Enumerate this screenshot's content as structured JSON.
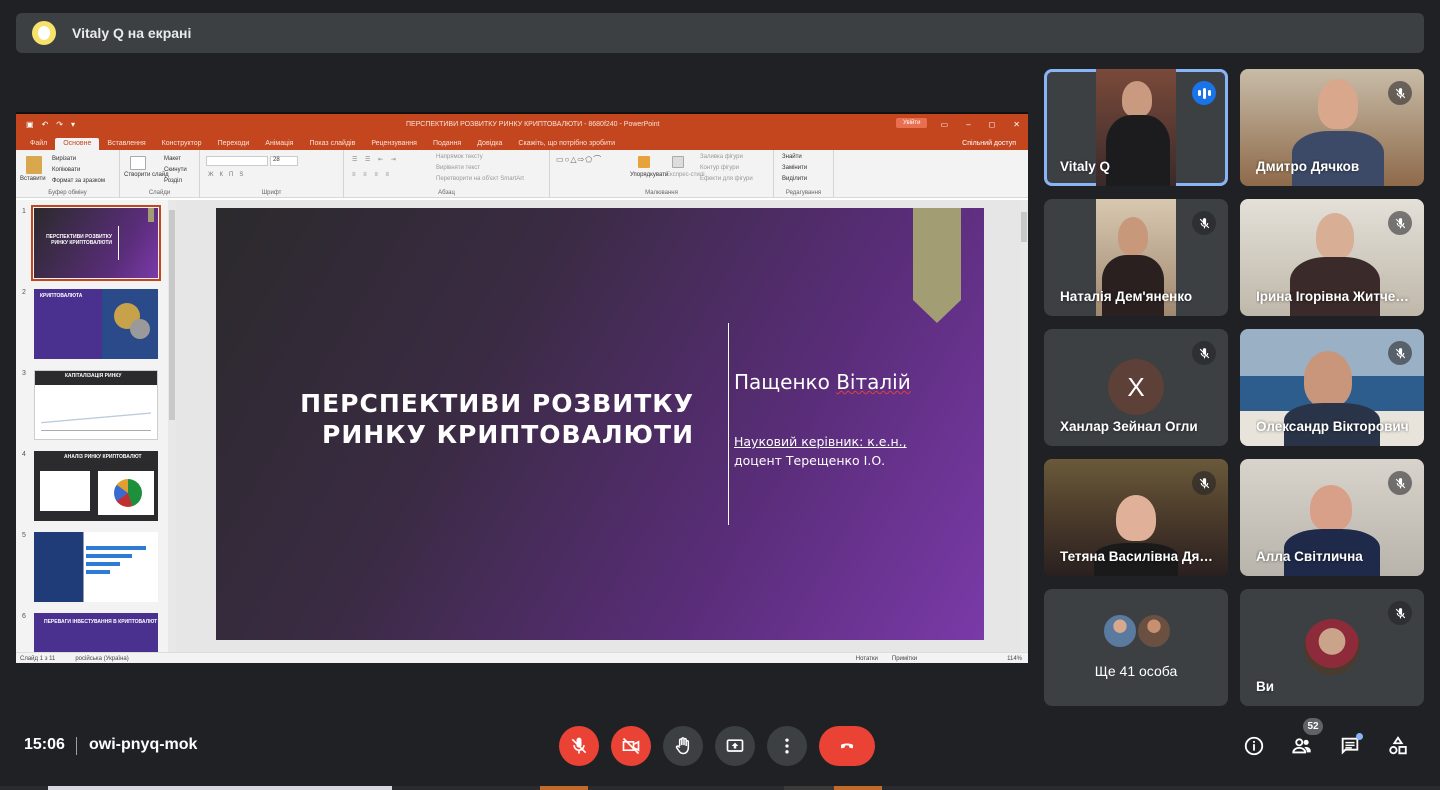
{
  "banner": {
    "text": "Vitaly Q на екрані"
  },
  "ppt": {
    "doc_title": "ПЕРСПЕКТИВИ РОЗВИТКУ РИНКУ КРИПТОВАЛЮТИ - 8680f240 - PowerPoint",
    "ukrainian_badge": "Увійти",
    "tabs": [
      "Файл",
      "Основне",
      "Вставлення",
      "Конструктор",
      "Переходи",
      "Анімація",
      "Показ слайдів",
      "Рецензування",
      "Подання",
      "Довідка",
      "Скажіть, що потрібно зробити"
    ],
    "share_label": "Спільний доступ",
    "ribbon": {
      "paste": "Вставити",
      "cut": "Вирізати",
      "copy": "Копіювати",
      "format_painter": "Формат за зразком",
      "clipboard": "Буфер обміну",
      "new_slide": "Створити слайд",
      "layout": "Макет",
      "reset": "Скинути",
      "section": "Розділ",
      "slides": "Слайди",
      "font_size": "28",
      "font": "Шрифт",
      "text_direction": "Напрямок тексту",
      "align_text": "Вирівняти текст",
      "smartart": "Перетворити на об'єкт SmartArt",
      "paragraph": "Абзац",
      "arrange": "Упорядкувати",
      "quick_styles": "Експрес-стилі",
      "shape_fill": "Заливка фігури",
      "shape_outline": "Контур фігури",
      "shape_effects": "Ефекти для фігури",
      "drawing": "Малювання",
      "find": "Знайти",
      "replace": "Замінити",
      "select": "Виділити",
      "editing": "Редагування"
    },
    "slide": {
      "title_line1": "ПЕРСПЕКТИВИ РОЗВИТКУ",
      "title_line2": "РИНКУ КРИПТОВАЛЮТИ",
      "author_first": "Пащенко",
      "author_second": "Віталій",
      "supervisor_line1": "Науковий керівник: к.е.н.,",
      "supervisor_line2": "доцент Терещенко І.О."
    },
    "thumbnails": [
      {
        "num": "1",
        "caption": "ПЕРСПЕКТИВИ РОЗВИТКУ РИНКУ КРИПТОВАЛЮТИ"
      },
      {
        "num": "2",
        "caption": "КРИПТОВАЛЮТА"
      },
      {
        "num": "3",
        "caption": "КАПІТАЛІЗАЦІЯ РИНКУ"
      },
      {
        "num": "4",
        "caption": "АНАЛІЗ РИНКУ КРИПТОВАЛЮТ"
      },
      {
        "num": "5",
        "caption": ""
      },
      {
        "num": "6",
        "caption": "ПЕРЕВАГИ ІНВЕСТУВАННЯ В КРИПТОВАЛЮТ"
      }
    ],
    "status": {
      "slide_of": "Слайд 1 з 11",
      "language": "російська (Україна)",
      "notes": "Нотатки",
      "comments": "Примітки",
      "zoom": "114%"
    }
  },
  "participants": [
    {
      "name": "Vitaly Q",
      "speaking": true
    },
    {
      "name": "Дмитро Дячков",
      "muted": true
    },
    {
      "name": "Наталія Дем'яненко",
      "muted": true
    },
    {
      "name": "Ірина Ігорівна Житченко",
      "muted": true
    },
    {
      "name": "Ханлар Зейнал Огли",
      "initial": "Х",
      "muted": true
    },
    {
      "name": "Олександр Вікторович",
      "muted": true
    },
    {
      "name": "Тетяна Василівна Дяченко",
      "muted": true
    },
    {
      "name": "Алла Світлична",
      "muted": true
    },
    {
      "name": "Ще 41 особа"
    },
    {
      "name": "Ви",
      "muted": true
    }
  ],
  "bottom": {
    "time": "15:06",
    "meeting_code": "owi-pnyq-mok",
    "people_count": "52"
  },
  "colors": {
    "accent_blue": "#8ab4f8",
    "end_red": "#ea4335",
    "ppt_orange": "#c4461f"
  }
}
